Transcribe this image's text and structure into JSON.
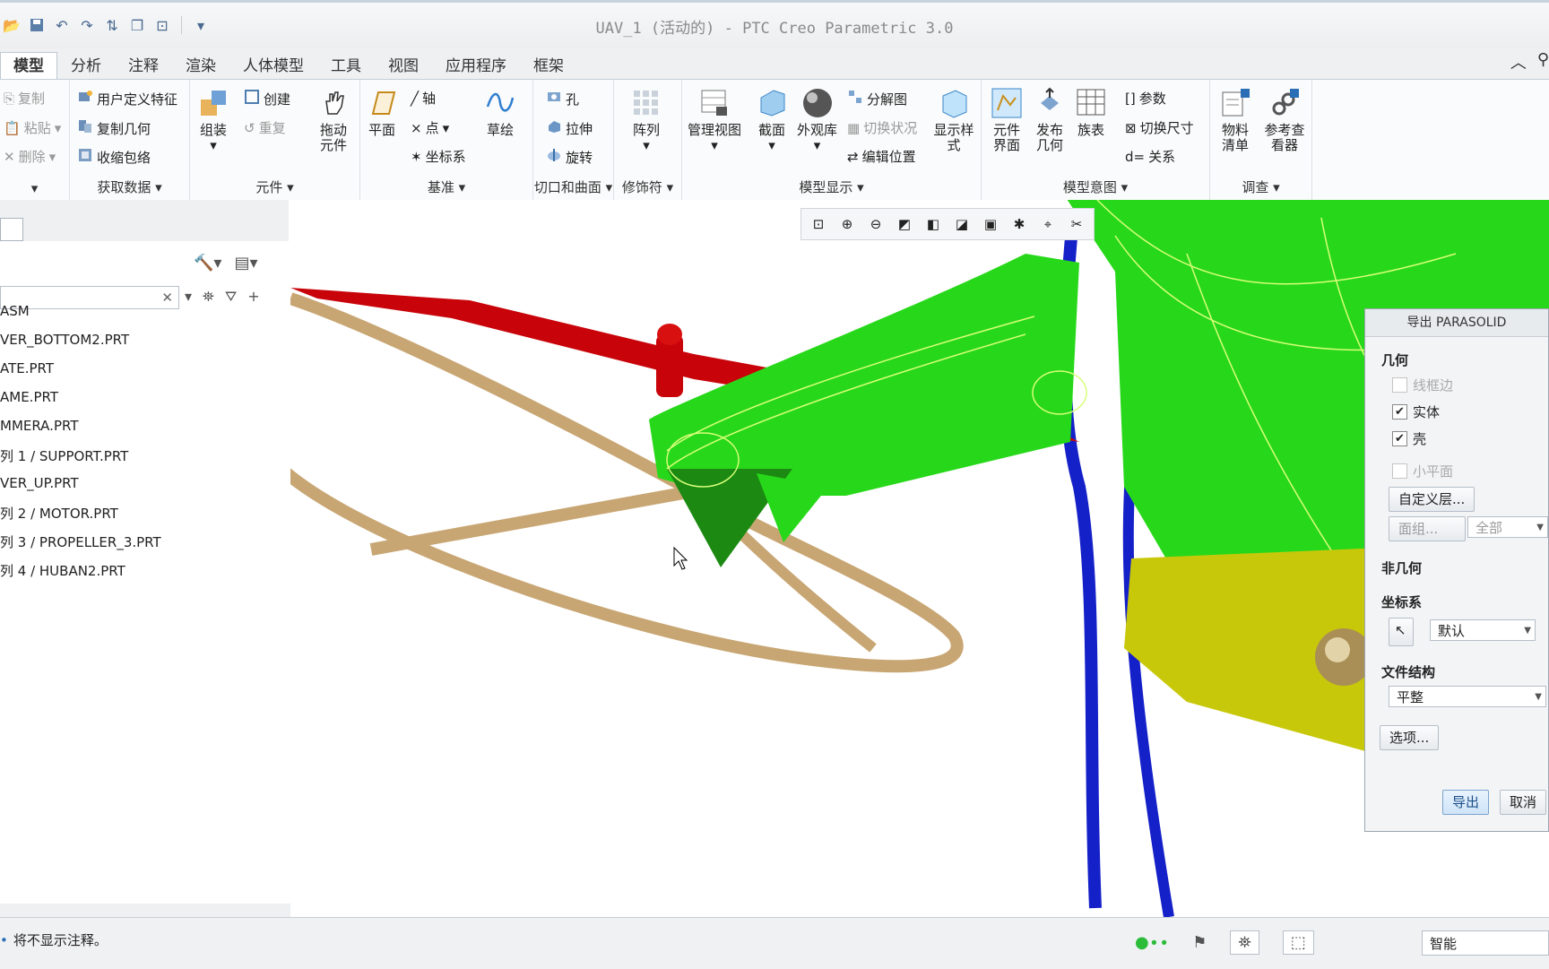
{
  "window": {
    "title": "UAV_1 (活动的) - PTC Creo Parametric 3.0"
  },
  "tabs": [
    "模型",
    "分析",
    "注释",
    "渲染",
    "人体模型",
    "工具",
    "视图",
    "应用程序",
    "框架"
  ],
  "ribbon": {
    "clipboard": {
      "copy": "复制",
      "paste": "粘贴",
      "delete": "删除"
    },
    "get_data": {
      "label": "获取数据",
      "udf": "用户定义特征",
      "copy_geom": "复制几何",
      "shrinkwrap": "收缩包络"
    },
    "component": {
      "label": "元件",
      "assemble": "组装",
      "create": "创建",
      "repeat": "重复",
      "drag": "拖动元件"
    },
    "datum": {
      "label": "基准",
      "plane": "平面",
      "axis": "轴",
      "point": "点",
      "csys": "坐标系",
      "sketch": "草绘"
    },
    "cut_surface": {
      "label": "切口和曲面",
      "hole": "孔",
      "extrude": "拉伸",
      "revolve": "旋转"
    },
    "modifiers": {
      "label": "修饰符",
      "pattern": "阵列"
    },
    "model_display": {
      "label": "模型显示",
      "manage_views": "管理视图",
      "section": "截面",
      "appearance": "外观库",
      "explode": "分解图",
      "toggle_status": "切换状况",
      "edit_position": "编辑位置",
      "display_style": "显示样式"
    },
    "model_intent": {
      "label": "模型意图",
      "comp_interface": "元件界面",
      "publish_geom": "发布几何",
      "family_table": "族表",
      "parameters": "参数",
      "switch_dims": "切换尺寸",
      "relations": "关系"
    },
    "investigate": {
      "label": "调查",
      "bom": "物料清单",
      "ref_viewer": "参考查看器"
    }
  },
  "tree": {
    "items": [
      "ASM",
      "VER_BOTTOM2.PRT",
      "ATE.PRT",
      "AME.PRT",
      "MMERA.PRT",
      "列 1 / SUPPORT.PRT",
      "VER_UP.PRT",
      "列 2 / MOTOR.PRT",
      "列 3 / PROPELLER_3.PRT",
      "列 4 / HUBAN2.PRT"
    ]
  },
  "dialog": {
    "title": "导出 PARASOLID",
    "geometry": "几何",
    "wireframe": "线框边",
    "solid": "实体",
    "shell": "壳",
    "facets": "小平面",
    "custom_layers": "自定义层...",
    "quilts": "面组...",
    "all": "全部",
    "non_geometry": "非几何",
    "csys": "坐标系",
    "csys_value": "默认",
    "file_structure": "文件结构",
    "file_structure_value": "平整",
    "options": "选项...",
    "export": "导出",
    "cancel": "取消"
  },
  "status": {
    "message": "将不显示注释。",
    "filter": "智能"
  },
  "colors": {
    "red": "#c8040a",
    "green": "#27d81a",
    "blue": "#1420c8",
    "tan": "#c8a673",
    "yellow": "#c8c80a"
  }
}
